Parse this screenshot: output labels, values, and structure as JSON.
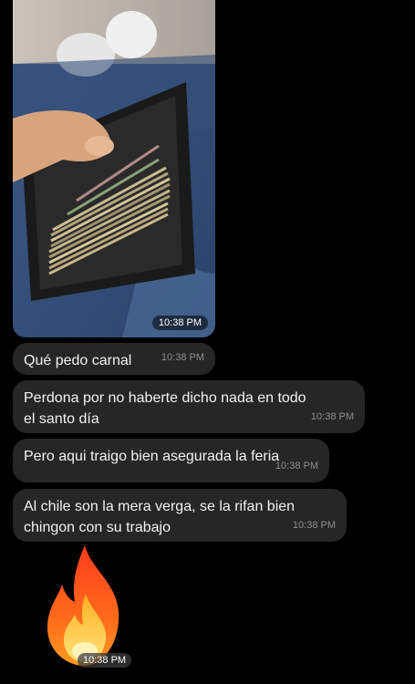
{
  "messages": [
    {
      "type": "image",
      "time": "10:38 PM"
    },
    {
      "type": "text",
      "text": "Qué pedo carnal",
      "time": "10:38 PM"
    },
    {
      "type": "text",
      "lines": [
        "Perdona por no haberte dicho nada en todo",
        "el santo día"
      ],
      "time": "10:38 PM"
    },
    {
      "type": "text",
      "text": "Pero aqui traigo bien asegurada la feria",
      "time": "10:38 PM"
    },
    {
      "type": "text",
      "lines": [
        "Al chile son la mera verga, se la rifan bien",
        "chingon con su trabajo"
      ],
      "time": "10:38 PM"
    },
    {
      "type": "emoji",
      "emoji": "fire",
      "time": "10:38 PM"
    }
  ],
  "colors": {
    "background": "#000000",
    "bubble": "#262626",
    "timestamp": "#8e8e93"
  }
}
